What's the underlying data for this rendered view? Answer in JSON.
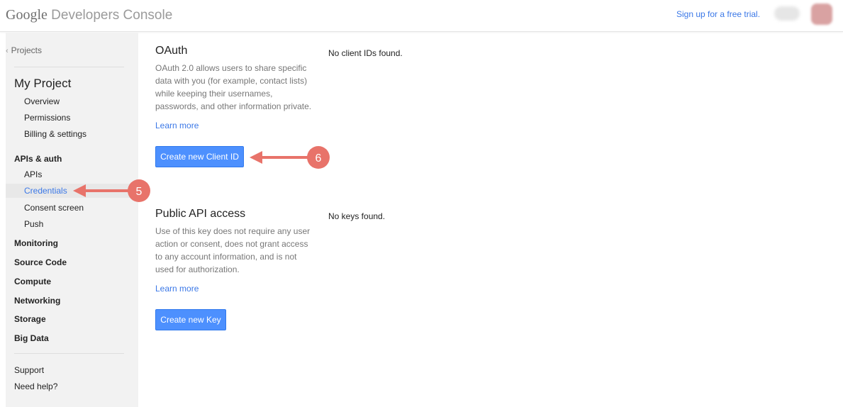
{
  "header": {
    "brand_google": "Google",
    "brand_product": " Developers Console",
    "signup_link": "Sign up for a free trial.",
    "avatar_icon": "user-avatar"
  },
  "sidebar": {
    "back_link": "Projects",
    "project_title": "My Project",
    "project_items": [
      "Overview",
      "Permissions",
      "Billing & settings"
    ],
    "apis_auth_label": "APIs & auth",
    "apis_auth_items": [
      "APIs",
      "Credentials",
      "Consent screen",
      "Push"
    ],
    "active_item": "Credentials",
    "sections": [
      "Monitoring",
      "Source Code",
      "Compute",
      "Networking",
      "Storage",
      "Big Data"
    ],
    "footer_items": [
      "Support",
      "Need help?"
    ]
  },
  "oauth": {
    "title": "OAuth",
    "description": "OAuth 2.0 allows users to share specific data with you (for example, contact lists) while keeping their usernames, passwords, and other information private.",
    "learn_more": "Learn more",
    "button": "Create new Client ID",
    "empty_message": "No client IDs found."
  },
  "public_api": {
    "title": "Public API access",
    "description": "Use of this key does not require any user action or consent, does not grant access to any account information, and is not used for authorization.",
    "learn_more": "Learn more",
    "button": "Create new Key",
    "empty_message": "No keys found."
  },
  "annotations": {
    "color": "#e8736a",
    "badges": [
      "5",
      "6"
    ]
  },
  "colors": {
    "link": "#3b78e7",
    "button": "#4d90fe",
    "sidebar_bg": "#f2f2f2"
  }
}
